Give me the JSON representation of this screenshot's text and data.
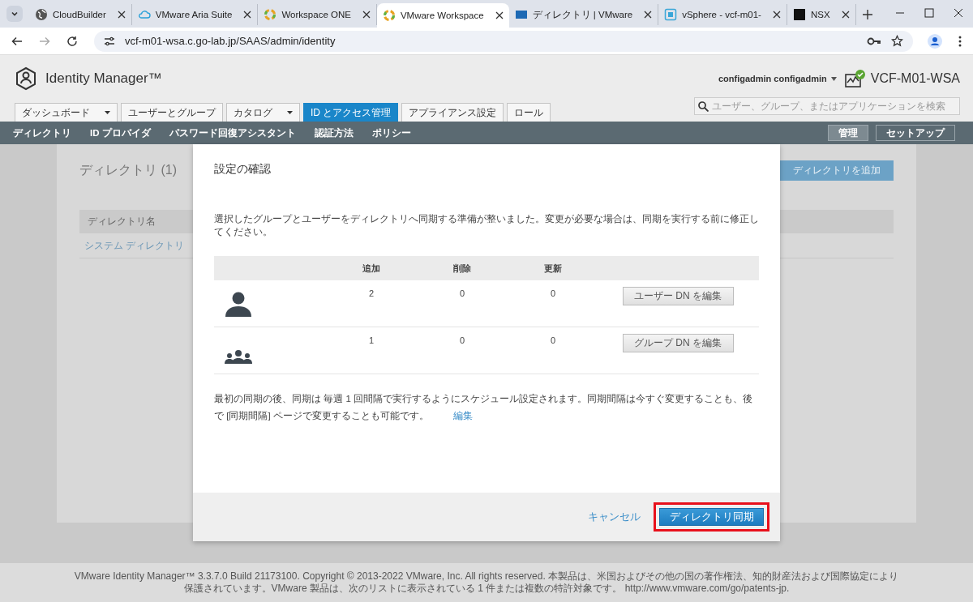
{
  "browser": {
    "tabs": [
      {
        "kind": "globe",
        "label": "CloudBuilder",
        "selected": false
      },
      {
        "kind": "cloud",
        "label": "VMware Aria Suite",
        "selected": false
      },
      {
        "kind": "ring",
        "label": "Workspace ONE",
        "selected": false
      },
      {
        "kind": "ring",
        "label": "VMware Workspace",
        "selected": true
      },
      {
        "kind": "vmw",
        "label": "ディレクトリ | VMware",
        "selected": false
      },
      {
        "kind": "vsphere",
        "label": "vSphere - vcf-m01-",
        "selected": false
      },
      {
        "kind": "nsx",
        "label": "NSX",
        "selected": false
      }
    ],
    "url": "vcf-m01-wsa.c.go-lab.jp/SAAS/admin/identity"
  },
  "header": {
    "product": "Identity Manager™",
    "user": "configadmin configadmin",
    "tenant": "VCF-M01-WSA",
    "search": {
      "placeholder": "ユーザー、グループ、またはアプリケーションを検索"
    },
    "tabs": [
      {
        "label": "ダッシュボード",
        "dropdown": true,
        "selected": false
      },
      {
        "label": "ユーザーとグループ",
        "dropdown": false,
        "selected": false
      },
      {
        "label": "カタログ",
        "dropdown": true,
        "selected": false
      },
      {
        "label": "ID とアクセス管理",
        "dropdown": false,
        "selected": true
      },
      {
        "label": "アプライアンス設定",
        "dropdown": false,
        "selected": false
      },
      {
        "label": "ロール",
        "dropdown": false,
        "selected": false
      }
    ]
  },
  "subnav": {
    "items": [
      {
        "label": "ディレクトリ"
      },
      {
        "label": "ID プロバイダ"
      },
      {
        "label": "パスワード回復アシスタント"
      },
      {
        "label": "認証方法"
      },
      {
        "label": "ポリシー"
      }
    ],
    "modes": [
      {
        "label": "管理",
        "selected": true
      },
      {
        "label": "セットアップ",
        "selected": false
      }
    ]
  },
  "page": {
    "title": "ディレクトリ (1)",
    "add_button": "ディレクトリを追加",
    "column": "ディレクトリ名",
    "rows": [
      "システム ディレクトリ"
    ]
  },
  "dialog": {
    "title": "設定の確認",
    "description": "選択したグループとユーザーをディレクトリへ同期する準備が整いました。変更が必要な場合は、同期を実行する前に修正してください。",
    "columns": [
      "追加",
      "削除",
      "更新"
    ],
    "rows": [
      {
        "kind": "user",
        "values": [
          "2",
          "0",
          "0"
        ],
        "button": "ユーザー DN を編集"
      },
      {
        "kind": "group",
        "values": [
          "1",
          "0",
          "0"
        ],
        "button": "グループ DN を編集"
      }
    ],
    "schedule": "最初の同期の後、同期は 毎週 1 回間隔で実行するようにスケジュール設定されます。同期間隔は今すぐ変更することも、後で [同期間隔] ページで変更することも可能です。",
    "edit_link": "編集",
    "cancel": "キャンセル",
    "confirm": {
      "label": "ディレクトリ同期",
      "highlighted": true
    }
  },
  "footer": {
    "lines": [
      "VMware Identity Manager™ 3.3.7.0 Build 21173100. Copyright © 2013-2022 VMware, Inc. All rights reserved. 本製品は、米国およびその他の国の著作権法、知的財産法および国際協定により",
      "保護されています。VMware 製品は、次のリストに表示されている 1 件または複数の特許対象です。 http://www.vmware.com/go/patents-jp."
    ]
  }
}
